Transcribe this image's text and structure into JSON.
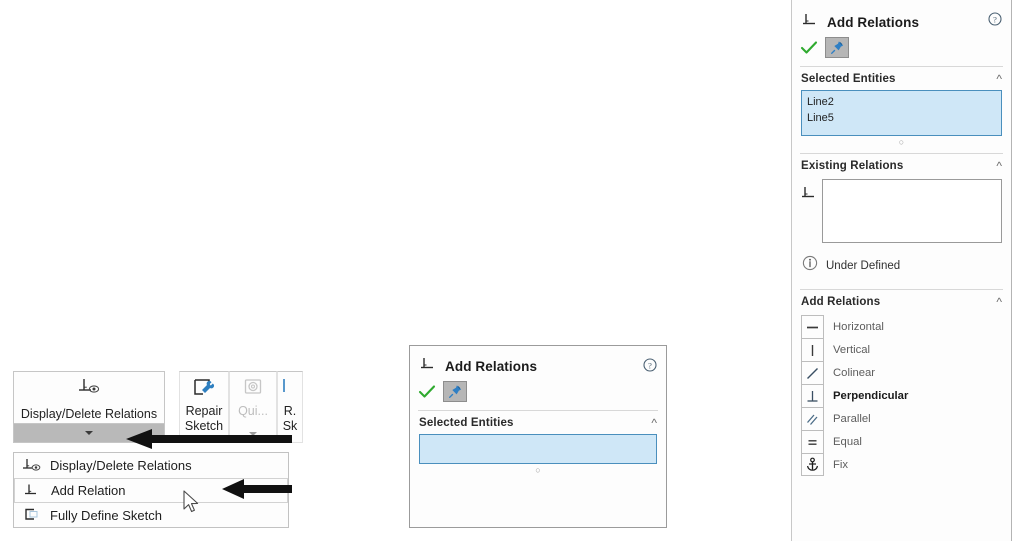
{
  "right_panel": {
    "title": "Add Relations",
    "title_icon": "perpendicular-relation-icon",
    "help_icon": "help-question-icon",
    "ok_icon": "green-check-icon",
    "pin_icon": "pushpin-icon",
    "sections": {
      "selected_entities": {
        "label": "Selected Entities",
        "collapse_icon": "chevron-up-icon",
        "items": [
          "Line2",
          "Line5"
        ]
      },
      "existing_relations": {
        "label": "Existing Relations",
        "collapse_icon": "chevron-up-icon",
        "icon": "perpendicular-relation-icon",
        "items": []
      },
      "status": {
        "icon": "info-icon",
        "text": "Under Defined"
      },
      "add_relations": {
        "label": "Add Relations",
        "collapse_icon": "chevron-up-icon",
        "items": [
          {
            "label": "Horizontal",
            "icon": "horizontal-relation-icon",
            "selected": false
          },
          {
            "label": "Vertical",
            "icon": "vertical-relation-icon",
            "selected": false
          },
          {
            "label": "Colinear",
            "icon": "colinear-relation-icon",
            "selected": false
          },
          {
            "label": "Perpendicular",
            "icon": "perpendicular-relation-icon",
            "selected": true
          },
          {
            "label": "Parallel",
            "icon": "parallel-relation-icon",
            "selected": false
          },
          {
            "label": "Equal",
            "icon": "equal-relation-icon",
            "selected": false
          },
          {
            "label": "Fix",
            "icon": "fix-anchor-icon",
            "selected": false
          }
        ]
      }
    }
  },
  "mid_panel": {
    "title": "Add Relations",
    "title_icon": "perpendicular-relation-icon",
    "help_icon": "help-question-icon",
    "ok_icon": "green-check-icon",
    "pin_icon": "pushpin-icon",
    "selected_entities": {
      "label": "Selected Entities",
      "collapse_icon": "chevron-up-icon",
      "items": []
    }
  },
  "ribbon": {
    "display_delete_relations": {
      "label": "Display/Delete Relations",
      "icon": "display-delete-relations-icon",
      "dropdown_caret": "caret-down-icon"
    },
    "repair_sketch": {
      "label_line1": "Repair",
      "label_line2": "Sketch",
      "icon": "repair-sketch-icon"
    },
    "quick_snaps": {
      "label": "Qui...",
      "icon": "quick-snaps-icon",
      "disabled": true,
      "dropdown_caret": "caret-down-icon"
    },
    "rapid_sketch": {
      "label_line1": "R.",
      "label_line2": "Sk",
      "icon": "rapid-sketch-icon"
    }
  },
  "dropdown_menu": {
    "items": [
      {
        "label": "Display/Delete Relations",
        "icon": "display-delete-relations-icon",
        "hovered": false
      },
      {
        "label": "Add Relation",
        "icon": "add-relation-icon",
        "hovered": true
      },
      {
        "label": "Fully Define Sketch",
        "icon": "fully-define-sketch-icon",
        "hovered": false
      }
    ]
  },
  "annotations": {
    "arrow1": "left-pointing-arrow",
    "arrow2": "left-pointing-arrow",
    "cursor": "mouse-pointer"
  },
  "colors": {
    "selection_fill": "#cfe7f7",
    "selection_border": "#4a8fbd",
    "check_green": "#2faa2f",
    "panel_bg": "#fdfdfd",
    "highlight_strip": "#b9b9b9"
  }
}
